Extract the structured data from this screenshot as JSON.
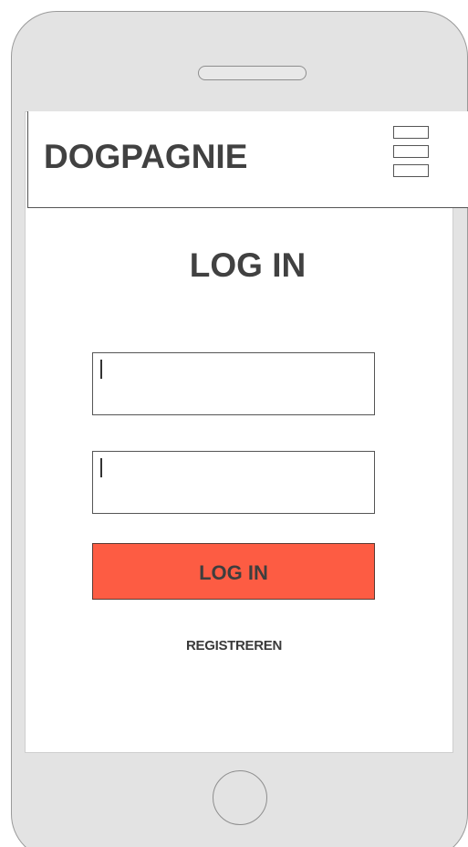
{
  "app": {
    "brand": "DOGPAGNIE"
  },
  "login": {
    "title": "LOG IN",
    "username_value": "",
    "password_value": "",
    "submit_label": "LOG IN",
    "register_label": "REGISTREREN"
  },
  "colors": {
    "button_accent": "#fd5c43",
    "text": "#414141",
    "device_frame": "#e3e3e3"
  },
  "icons": {
    "menu": "hamburger-menu-icon"
  }
}
